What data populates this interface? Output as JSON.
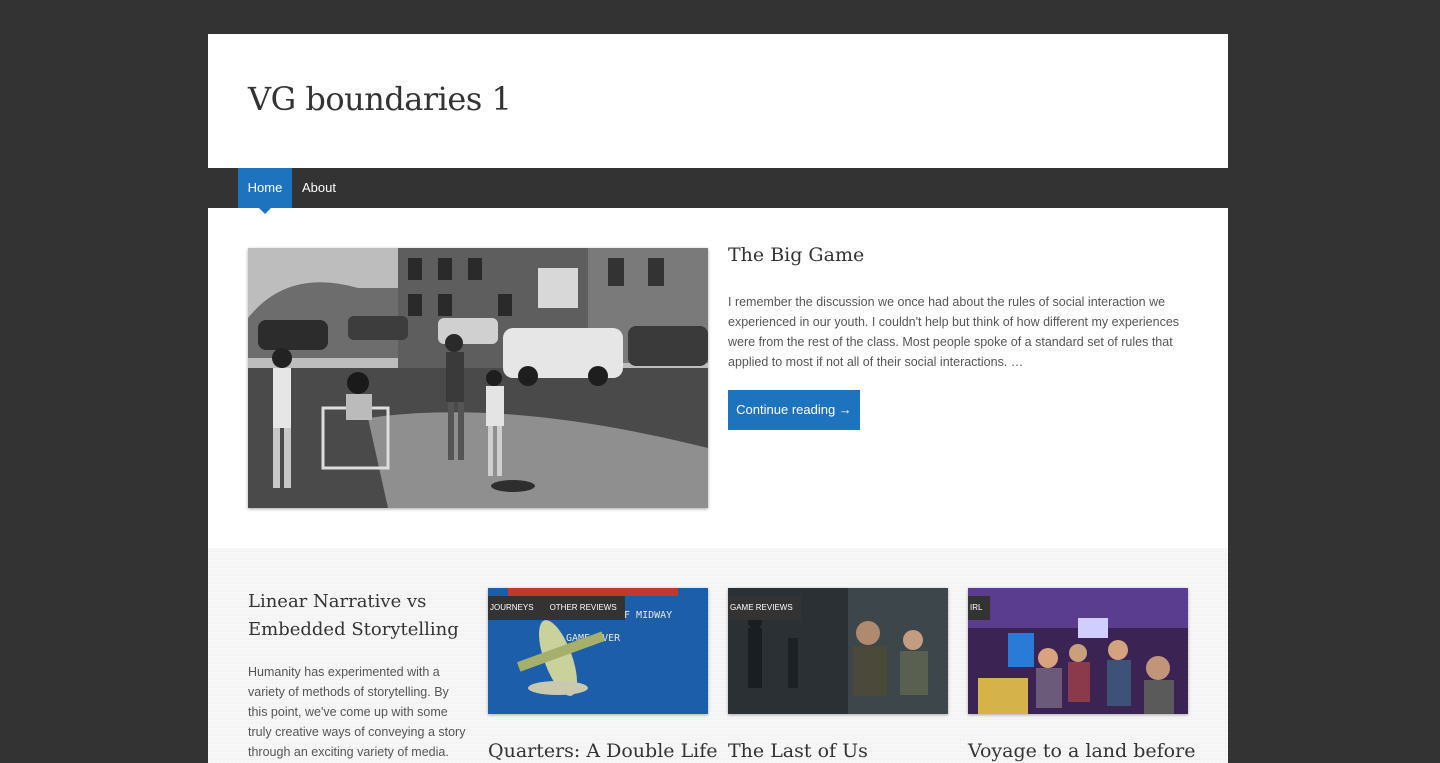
{
  "site": {
    "title": "VG boundaries 1"
  },
  "nav": {
    "items": [
      {
        "label": "Home"
      },
      {
        "label": "About"
      }
    ]
  },
  "featured": {
    "title": "The Big Game",
    "excerpt": "I remember the discussion we once had about the rules of social interaction we experienced in our youth.  I couldn't help but think of how different my experiences were from the rest of the class.  Most people spoke of a standard set of rules that applied to most if not all of their social interactions. …",
    "button": "Continue reading →"
  },
  "side_post": {
    "title": "Linear Narrative vs Embedded Storytelling",
    "excerpt": "Humanity has experimented with a variety of methods of storytelling. By this point, we've come up with some truly creative ways of conveying a story through an exciting variety of media."
  },
  "cards": [
    {
      "title": "Quarters: A Double Life",
      "tags": [
        "Journeys",
        "Other Reviews"
      ],
      "image_text": [
        "OF MIDWAY",
        "GAME OVER"
      ]
    },
    {
      "title": "The Last of Us",
      "tags": [
        "Game Reviews"
      ]
    },
    {
      "title": "Voyage to a land before",
      "tags": [
        "IRL"
      ]
    }
  ]
}
